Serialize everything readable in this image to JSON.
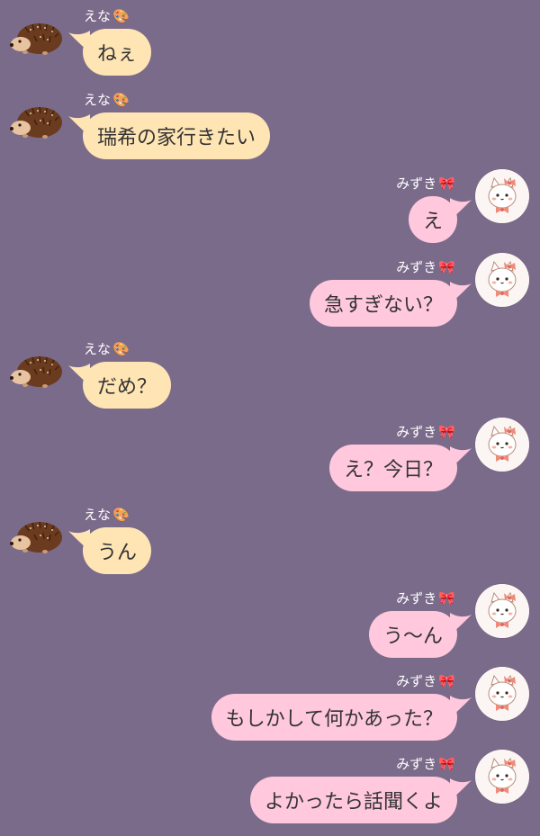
{
  "colors": {
    "background": "#7b6b8b",
    "left_bubble": "#ffe5b4",
    "right_bubble": "#ffc8dd",
    "text": "#333333",
    "name_text": "#ffffff"
  },
  "participants": {
    "ena": {
      "name": "えな",
      "badge": "🎨",
      "avatar_icon": "hedgehog-icon"
    },
    "mizuki": {
      "name": "みずき",
      "badge": "🎀",
      "avatar_icon": "kitten-with-bow-icon"
    }
  },
  "messages": [
    {
      "sender": "ena",
      "side": "left",
      "text": "ねぇ"
    },
    {
      "sender": "ena",
      "side": "left",
      "text": "瑞希の家行きたい"
    },
    {
      "sender": "mizuki",
      "side": "right",
      "text": "え"
    },
    {
      "sender": "mizuki",
      "side": "right",
      "text": "急すぎない？"
    },
    {
      "sender": "ena",
      "side": "left",
      "text": "だめ？"
    },
    {
      "sender": "mizuki",
      "side": "right",
      "text": "え？今日？"
    },
    {
      "sender": "ena",
      "side": "left",
      "text": "うん"
    },
    {
      "sender": "mizuki",
      "side": "right",
      "text": "う〜ん"
    },
    {
      "sender": "mizuki",
      "side": "right",
      "text": "もしかして何かあった？"
    },
    {
      "sender": "mizuki",
      "side": "right",
      "text": "よかったら話聞くよ"
    }
  ]
}
